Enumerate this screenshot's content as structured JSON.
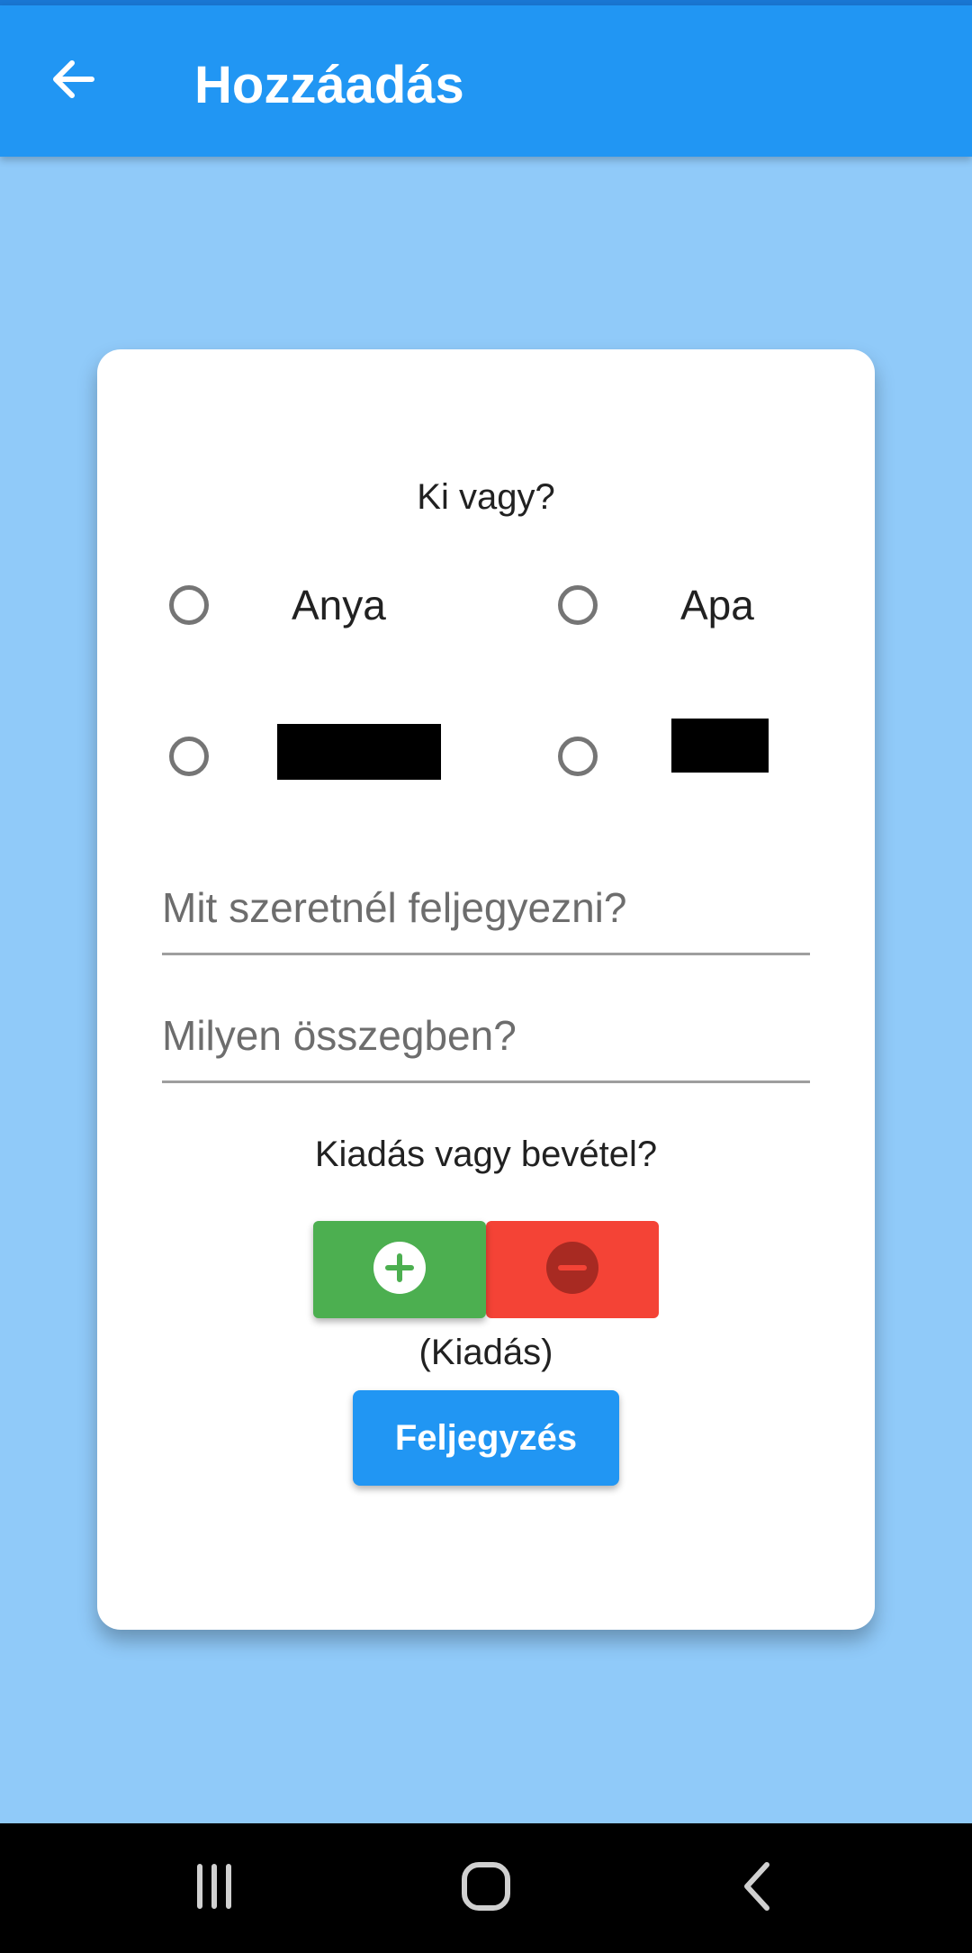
{
  "app_bar": {
    "title": "Hozzáadás",
    "back_icon": "arrow-back-icon",
    "color": "#2196F3"
  },
  "form": {
    "who_label": "Ki vagy?",
    "people": [
      {
        "label": "Anya",
        "selected": false
      },
      {
        "label": "Apa",
        "selected": false
      },
      {
        "label": "",
        "selected": false
      },
      {
        "label": "",
        "selected": false
      }
    ],
    "note_field": {
      "placeholder": "Mit szeretnél feljegyezni?",
      "value": ""
    },
    "amount_field": {
      "placeholder": "Milyen összegben?",
      "value": ""
    },
    "type_label": "Kiadás vagy bevétel?",
    "type_toggle": {
      "plus_icon": "plus-circle-icon",
      "minus_icon": "minus-circle-icon",
      "plus_color": "#4CAF50",
      "minus_color": "#F44336"
    },
    "type_status": "(Kiadás)",
    "submit_label": "Feljegyzés"
  },
  "system_nav": {
    "recents_icon": "recents-icon",
    "home_icon": "home-icon",
    "back_icon": "nav-back-icon"
  },
  "colors": {
    "background": "#90CAF9",
    "card": "#FFFFFF",
    "button": "#2196F3"
  }
}
